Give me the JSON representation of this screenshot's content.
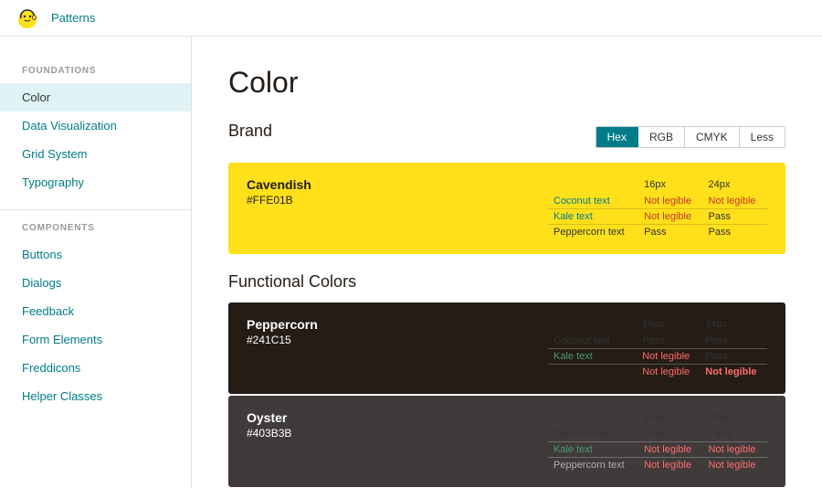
{
  "nav": {
    "patterns_label": "Patterns"
  },
  "sidebar": {
    "foundations_label": "FOUNDATIONS",
    "components_label": "COMPONENTS",
    "items_foundations": [
      {
        "label": "Color",
        "active": true
      },
      {
        "label": "Data Visualization",
        "active": false
      },
      {
        "label": "Grid System",
        "active": false
      },
      {
        "label": "Typography",
        "active": false
      }
    ],
    "items_components": [
      {
        "label": "Buttons",
        "active": false
      },
      {
        "label": "Dialogs",
        "active": false
      },
      {
        "label": "Feedback",
        "active": false
      },
      {
        "label": "Form Elements",
        "active": false
      },
      {
        "label": "Freddicons",
        "active": false
      },
      {
        "label": "Helper Classes",
        "active": false
      }
    ]
  },
  "content": {
    "page_title": "Color",
    "brand_title": "Brand",
    "functional_title": "Functional Colors",
    "format_buttons": [
      "Hex",
      "RGB",
      "CMYK",
      "Less"
    ],
    "active_format": "Hex",
    "swatches": {
      "cavendish": {
        "name": "Cavendish",
        "hex": "#FFE01B",
        "size_16": "16px",
        "size_24": "24px",
        "rows": [
          {
            "label": "Coconut text",
            "color": "coconut",
            "v16": "Not legible",
            "v24": "Not legible",
            "v16_class": "not-legible",
            "v24_class": "not-legible"
          },
          {
            "label": "Kale text",
            "color": "kale",
            "v16": "Not legible",
            "v24": "Pass",
            "v16_class": "not-legible",
            "v24_class": "pass"
          },
          {
            "label": "Peppercorn text",
            "color": "peppercorn",
            "v16": "Pass",
            "v24": "Pass",
            "v16_class": "pass",
            "v24_class": "pass"
          }
        ]
      },
      "peppercorn": {
        "name": "Peppercorn",
        "hex": "#241C15",
        "size_16": "16px",
        "size_24": "24px",
        "rows": [
          {
            "label": "Coconut text",
            "color": "coconut-light",
            "v16": "Pass",
            "v24": "Pass",
            "v16_class": "pass",
            "v24_class": "pass"
          },
          {
            "label": "Kale text",
            "color": "kale",
            "v16": "Not legible",
            "v24": "Pass",
            "v16_class": "not-legible",
            "v24_class": "pass"
          },
          {
            "label": "",
            "color": "",
            "v16": "Not legible",
            "v24": "Not legible",
            "v16_class": "not-legible",
            "v24_class": "not-legible"
          }
        ]
      },
      "oyster": {
        "name": "Oyster",
        "hex": "#403B3B",
        "size_16": "16px",
        "size_24": "24px",
        "rows": [
          {
            "label": "Coconut text",
            "color": "coconut-light",
            "v16": "Pass",
            "v24": "Pass",
            "v16_class": "pass",
            "v24_class": "pass"
          },
          {
            "label": "Kale text",
            "color": "kale",
            "v16": "Not legible",
            "v24": "Not legible",
            "v16_class": "not-legible",
            "v24_class": "not-legible"
          },
          {
            "label": "Peppercorn text",
            "color": "peppercorn-light",
            "v16": "Not legible",
            "v24": "Not legible",
            "v16_class": "not-legible",
            "v24_class": "not-legible"
          }
        ]
      }
    }
  }
}
